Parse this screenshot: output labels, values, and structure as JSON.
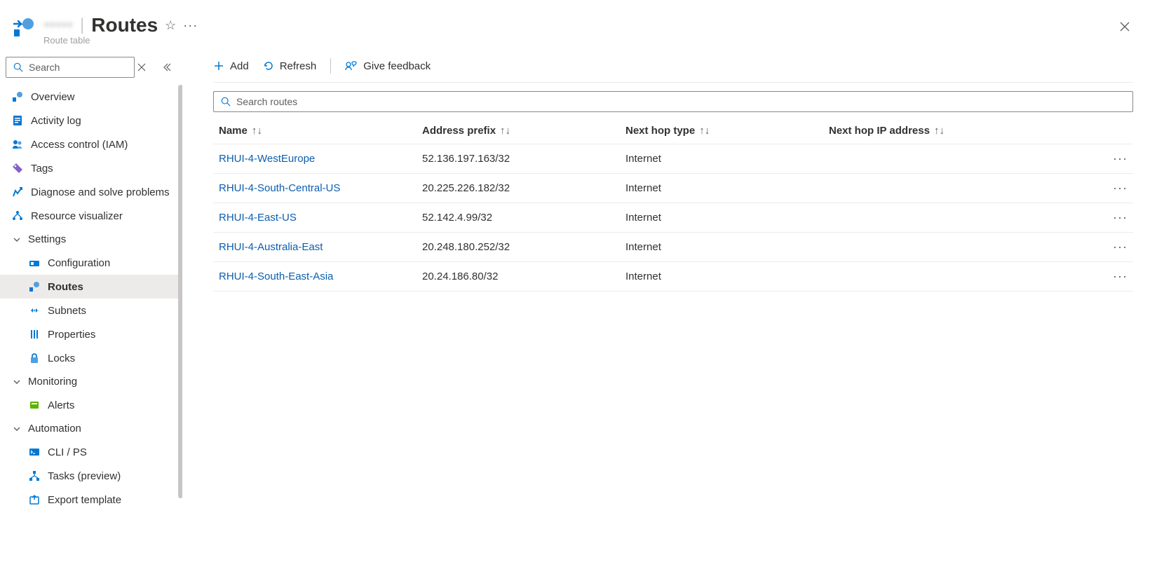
{
  "header": {
    "resource_name": "•••••",
    "title": "Routes",
    "subtitle": "Route table"
  },
  "sidebar": {
    "search_placeholder": "Search",
    "items": {
      "overview": "Overview",
      "activity_log": "Activity log",
      "iam": "Access control (IAM)",
      "tags": "Tags",
      "diagnose": "Diagnose and solve problems",
      "resource_viz": "Resource visualizer"
    },
    "sections": {
      "settings": {
        "label": "Settings",
        "items": {
          "configuration": "Configuration",
          "routes": "Routes",
          "subnets": "Subnets",
          "properties": "Properties",
          "locks": "Locks"
        }
      },
      "monitoring": {
        "label": "Monitoring",
        "items": {
          "alerts": "Alerts"
        }
      },
      "automation": {
        "label": "Automation",
        "items": {
          "clips": "CLI / PS",
          "tasks": "Tasks (preview)",
          "export_template": "Export template"
        }
      }
    }
  },
  "toolbar": {
    "add": "Add",
    "refresh": "Refresh",
    "feedback": "Give feedback"
  },
  "table": {
    "search_placeholder": "Search routes",
    "columns": {
      "name": "Name",
      "address_prefix": "Address prefix",
      "next_hop_type": "Next hop type",
      "next_hop_ip": "Next hop IP address"
    },
    "rows": [
      {
        "name": "RHUI-4-WestEurope",
        "address_prefix": "52.136.197.163/32",
        "next_hop_type": "Internet",
        "next_hop_ip": ""
      },
      {
        "name": "RHUI-4-South-Central-US",
        "address_prefix": "20.225.226.182/32",
        "next_hop_type": "Internet",
        "next_hop_ip": ""
      },
      {
        "name": "RHUI-4-East-US",
        "address_prefix": "52.142.4.99/32",
        "next_hop_type": "Internet",
        "next_hop_ip": ""
      },
      {
        "name": "RHUI-4-Australia-East",
        "address_prefix": "20.248.180.252/32",
        "next_hop_type": "Internet",
        "next_hop_ip": ""
      },
      {
        "name": "RHUI-4-South-East-Asia",
        "address_prefix": "20.24.186.80/32",
        "next_hop_type": "Internet",
        "next_hop_ip": ""
      }
    ]
  }
}
